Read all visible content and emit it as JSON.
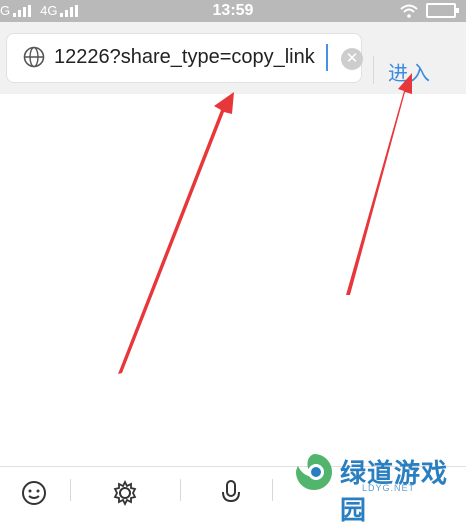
{
  "status_bar": {
    "carrier_left": "G",
    "network": "4G",
    "time": "13:59"
  },
  "address_bar": {
    "url": "12226?share_type=copy_link",
    "enter_label": "进入"
  },
  "watermark": {
    "brand": "绿道游戏园",
    "sub": "LDYG.NET"
  },
  "colors": {
    "status_bar_bg": "#b9b9b9",
    "accent": "#3b8be0",
    "arrow": "#e8373b"
  },
  "icons": [
    "globe-icon",
    "clear-icon",
    "emoji-icon",
    "gear-icon",
    "microphone-icon",
    "wifi-icon",
    "battery-icon"
  ]
}
